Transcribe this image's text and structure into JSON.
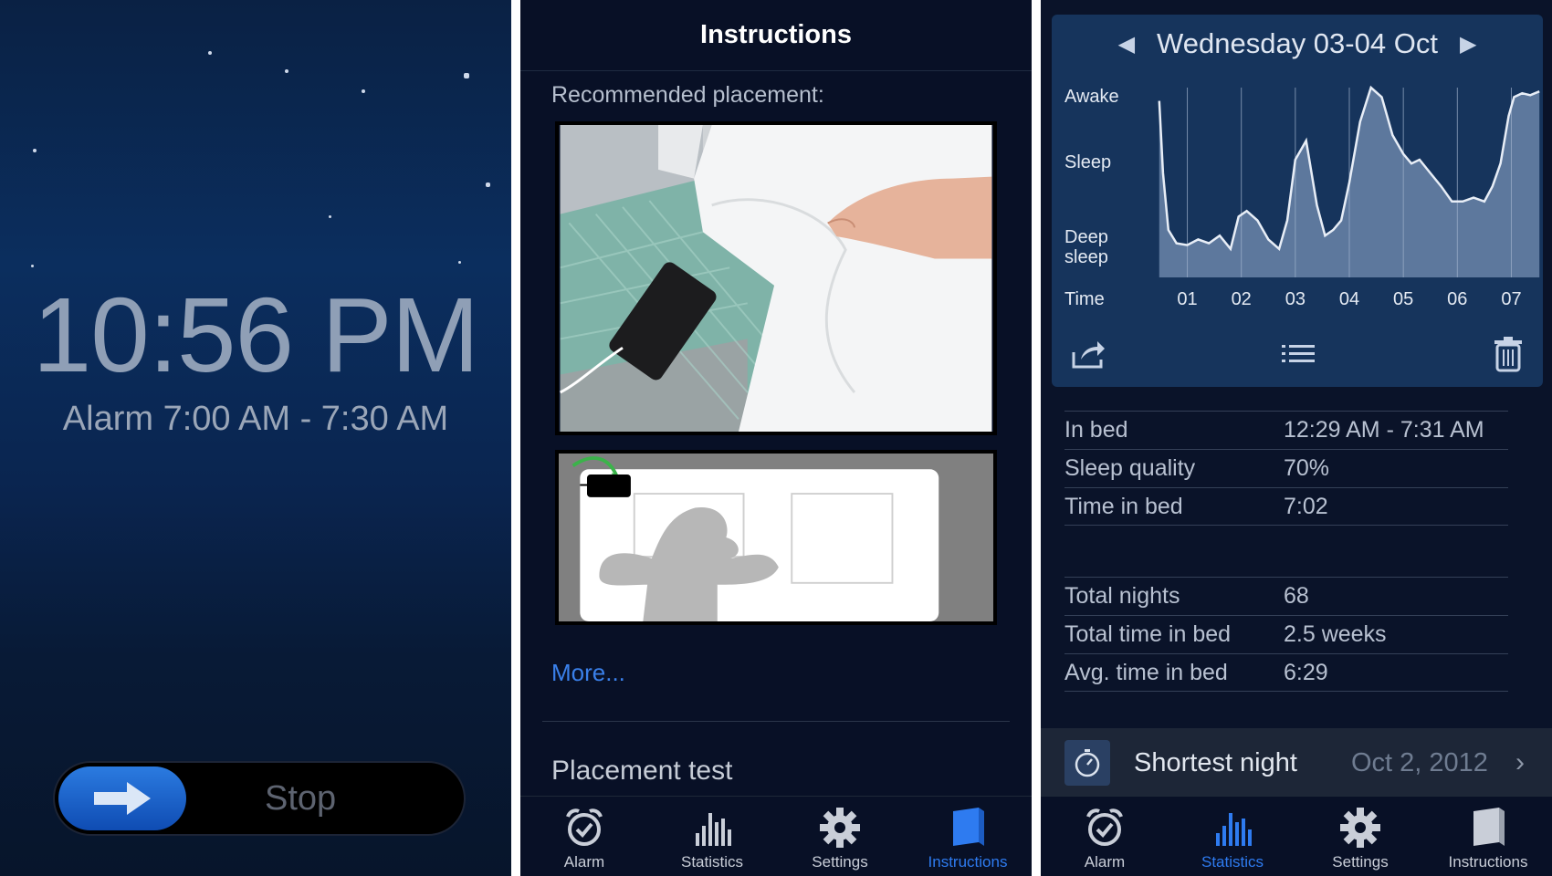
{
  "alarm_screen": {
    "time": "10:56 PM",
    "alarm_range": "Alarm 7:00 AM - 7:30 AM",
    "stop_label": "Stop",
    "icons": [
      "moon-icon",
      "arrow-right-icon"
    ]
  },
  "instructions_screen": {
    "title": "Instructions",
    "subtitle": "Recommended placement:",
    "more_link": "More...",
    "section_title": "Placement test"
  },
  "tabs": [
    {
      "label": "Alarm",
      "icon": "alarm-clock-icon"
    },
    {
      "label": "Statistics",
      "icon": "bar-chart-icon"
    },
    {
      "label": "Settings",
      "icon": "gear-icon"
    },
    {
      "label": "Instructions",
      "icon": "book-icon"
    }
  ],
  "statistics_screen": {
    "date": "Wednesday 03-04 Oct",
    "rows": [
      {
        "label": "In bed",
        "value": "12:29 AM - 7:31 AM"
      },
      {
        "label": "Sleep quality",
        "value": "70%"
      },
      {
        "label": "Time in bed",
        "value": "7:02"
      }
    ],
    "totals": [
      {
        "label": "Total nights",
        "value": "68"
      },
      {
        "label": "Total time in bed",
        "value": "2.5 weeks"
      },
      {
        "label": "Avg. time in bed",
        "value": "6:29"
      }
    ],
    "record": {
      "title": "Shortest night",
      "date": "Oct 2, 2012"
    }
  },
  "colors": {
    "accent": "#2e7bf0",
    "chart_bg": "#16345c",
    "chart_fill": "#6a85a8"
  },
  "chart_data": {
    "type": "area",
    "ylabels": [
      "Awake",
      "Sleep",
      "Deep\nsleep"
    ],
    "ylabel_time": "Time",
    "xticks": [
      "01",
      "02",
      "03",
      "04",
      "05",
      "06",
      "07"
    ],
    "x": [
      0.48,
      0.55,
      0.65,
      0.8,
      1.0,
      1.2,
      1.4,
      1.6,
      1.8,
      1.95,
      2.1,
      2.3,
      2.5,
      2.7,
      2.85,
      3.0,
      3.2,
      3.4,
      3.55,
      3.7,
      3.85,
      4.0,
      4.2,
      4.4,
      4.6,
      4.8,
      5.0,
      5.15,
      5.3,
      5.5,
      5.7,
      5.9,
      6.1,
      6.3,
      6.5,
      6.65,
      6.8,
      6.95,
      7.05,
      7.2,
      7.35,
      7.52
    ],
    "y": [
      0.93,
      0.55,
      0.25,
      0.18,
      0.17,
      0.2,
      0.18,
      0.22,
      0.15,
      0.32,
      0.35,
      0.3,
      0.2,
      0.15,
      0.3,
      0.62,
      0.72,
      0.38,
      0.22,
      0.25,
      0.3,
      0.5,
      0.82,
      1.0,
      0.95,
      0.75,
      0.65,
      0.6,
      0.62,
      0.55,
      0.48,
      0.4,
      0.4,
      0.42,
      0.4,
      0.48,
      0.6,
      0.85,
      0.95,
      0.97,
      0.96,
      0.98
    ],
    "ylim": [
      0,
      1
    ]
  }
}
